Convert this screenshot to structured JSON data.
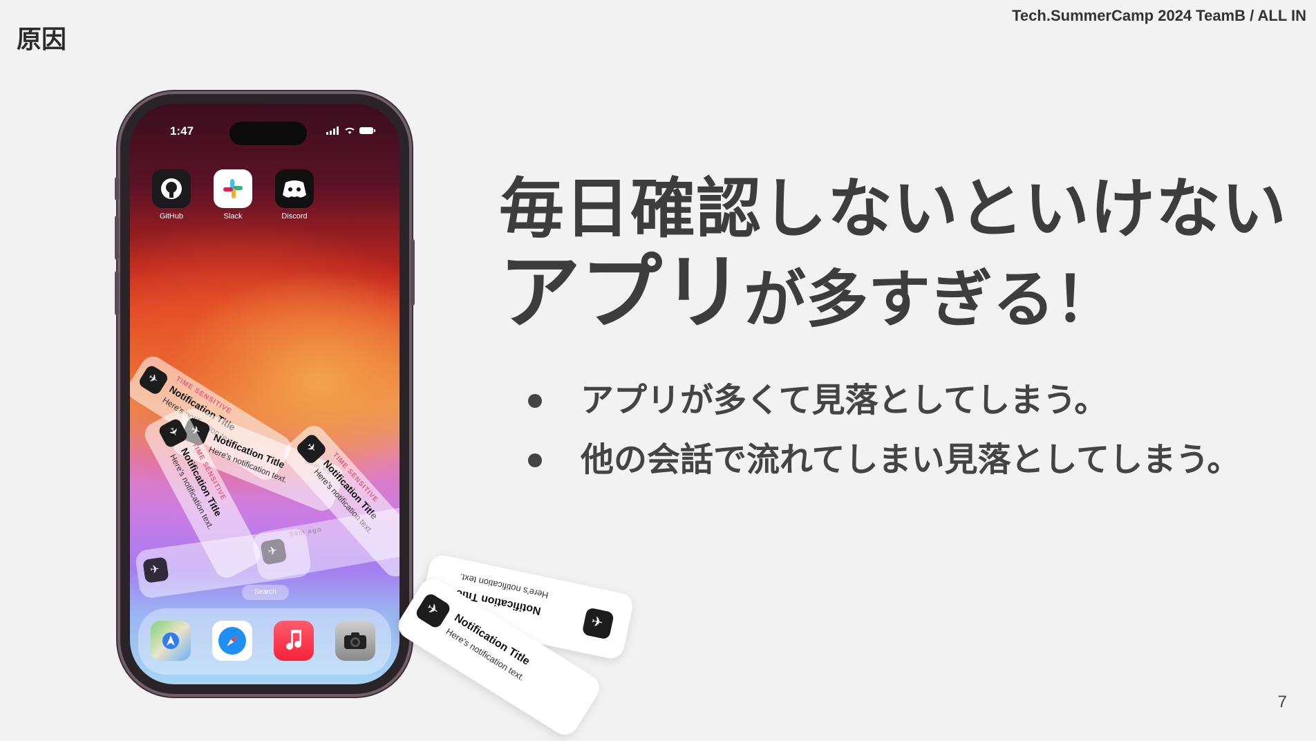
{
  "slide": {
    "title": "原因",
    "header": "Tech.SummerCamp 2024 TeamB / ALL IN",
    "page_number": "7"
  },
  "headline": {
    "line1": "毎日確認しないといけない",
    "line2_big": "アプリ",
    "line2_mid": "が多すぎる！"
  },
  "bullets": [
    "アプリが多くて見落としてしまう。",
    "他の会話で流れてしまい見落としてしまう。"
  ],
  "phone": {
    "time": "1:47",
    "apps": [
      {
        "label": "GitHub",
        "icon": "github-icon"
      },
      {
        "label": "Slack",
        "icon": "slack-icon"
      },
      {
        "label": "Discord",
        "icon": "discord-icon"
      }
    ],
    "dock": [
      {
        "icon": "maps-icon"
      },
      {
        "icon": "safari-icon"
      },
      {
        "icon": "music-icon"
      },
      {
        "icon": "camera-icon"
      }
    ],
    "search_label": "Search",
    "notification": {
      "tag": "TIME SENSITIVE",
      "title": "Notification Title",
      "text": "Here's notification text.",
      "time": "34m ago"
    }
  },
  "colors": {
    "background": "#f2f2f2",
    "text": "#3d3d3d"
  }
}
